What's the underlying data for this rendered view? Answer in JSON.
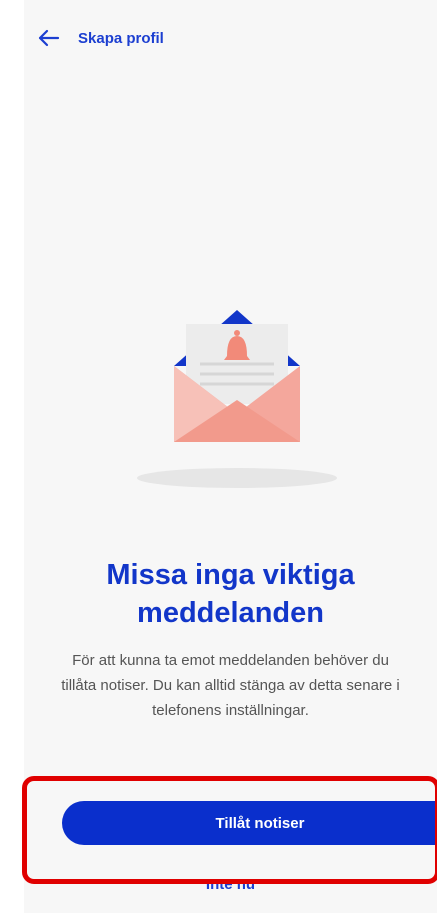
{
  "header": {
    "back_icon": "arrow-left-icon",
    "title": "Skapa profil"
  },
  "illustration": {
    "icon": "envelope-bell-icon",
    "colors": {
      "envelope_front": "#f4a79c",
      "envelope_left": "#f7c1b8",
      "letter": "#ececec",
      "bell": "#f28a79",
      "flap": "#1236c9",
      "shadow": "#e6e6e6"
    }
  },
  "main": {
    "headline": "Missa inga viktiga meddelanden",
    "body": "För att kunna ta emot meddelanden behöver du tillåta notiser. Du kan alltid stänga av detta senare i telefonens inställningar."
  },
  "actions": {
    "primary_label": "Tillåt notiser",
    "secondary_label": "Inte nu"
  },
  "colors": {
    "accent": "#0a2fcc",
    "highlight": "#e00000",
    "background": "#f7f7f7"
  }
}
